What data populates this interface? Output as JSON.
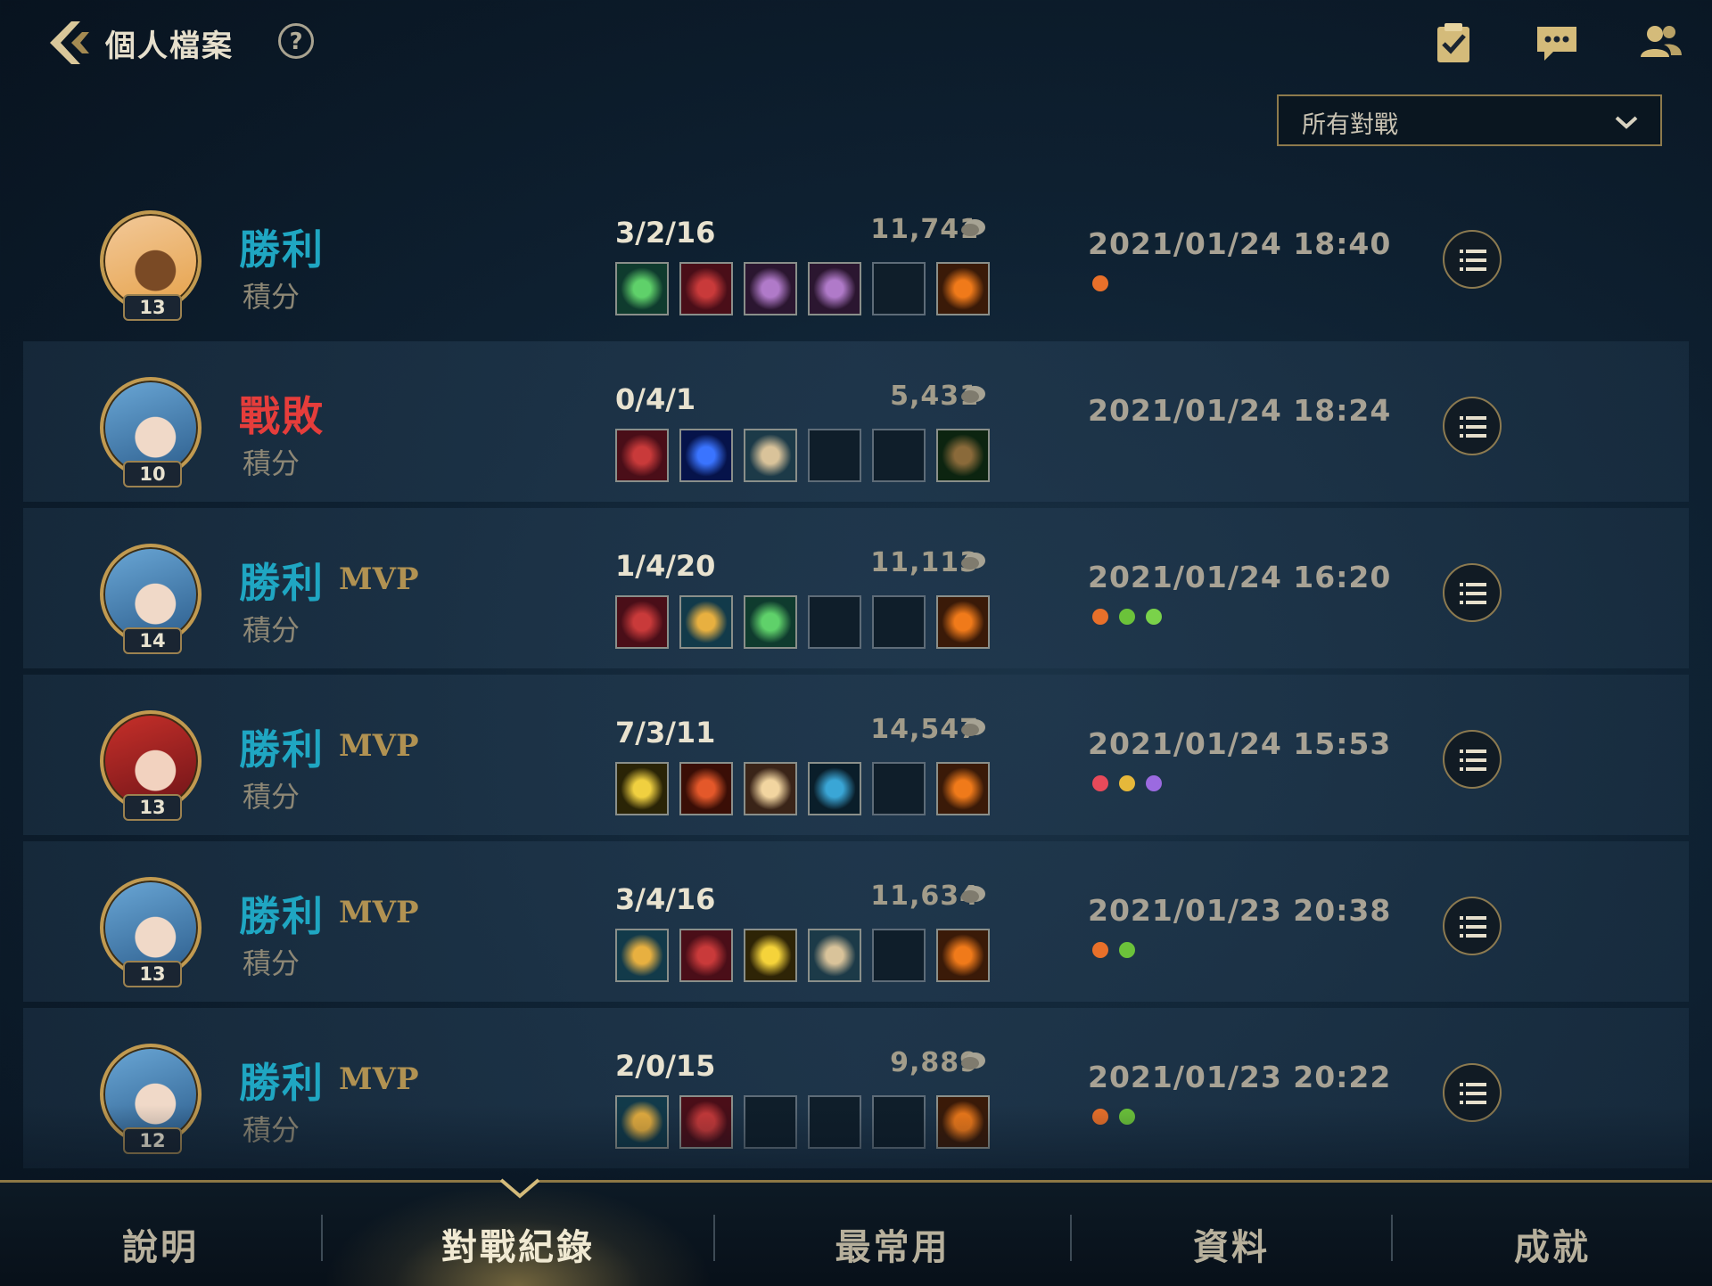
{
  "header": {
    "title": "個人檔案",
    "help_label": "?",
    "filter_value": "所有對戰"
  },
  "colors": {
    "win": "#1fa6c2",
    "lose": "#e53d3b",
    "mvp": "#b19252",
    "gold_border": "#c19a50"
  },
  "matches": [
    {
      "result": "勝利",
      "outcome": "win",
      "mvp": "",
      "mode": "積分",
      "level": "13",
      "kda": "3/2/16",
      "gold": "11,741",
      "datetime": "2021/01/24 18:40",
      "champion_icon": "blonde-champion-portrait",
      "items": [
        "green-gem-item-icon",
        "red-shield-item-icon",
        "spiked-orb-item-icon",
        "spiked-orb-item-icon",
        "empty-slot",
        "winged-ward-trinket-icon"
      ],
      "badges": [
        "orange-streak-badge-icon"
      ]
    },
    {
      "result": "戰敗",
      "outcome": "lose",
      "mvp": "",
      "mode": "積分",
      "level": "10",
      "kda": "0/4/1",
      "gold": "5,431",
      "datetime": "2021/01/24 18:24",
      "champion_icon": "blue-hair-champion-portrait",
      "items": [
        "red-shield-item-icon",
        "blue-flame-item-icon",
        "scroll-item-icon",
        "empty-slot",
        "empty-slot",
        "green-boots-item-icon"
      ],
      "badges": []
    },
    {
      "result": "勝利",
      "outcome": "win",
      "mvp": "MVP",
      "mode": "積分",
      "level": "14",
      "kda": "1/4/20",
      "gold": "11,113",
      "datetime": "2021/01/24 16:20",
      "champion_icon": "blue-hair-champion-portrait",
      "items": [
        "red-shield-item-icon",
        "feather-staff-item-icon",
        "green-gem-item-icon",
        "empty-slot",
        "empty-slot",
        "winged-ward-trinket-icon"
      ],
      "badges": [
        "orange-streak-badge-icon",
        "green-flag-badge-icon",
        "green-ward-badge-icon"
      ]
    },
    {
      "result": "勝利",
      "outcome": "win",
      "mvp": "MVP",
      "mode": "積分",
      "level": "13",
      "kda": "7/3/11",
      "gold": "14,547",
      "datetime": "2021/01/24 15:53",
      "champion_icon": "red-hair-champion-portrait",
      "items": [
        "golden-sword-item-icon",
        "red-blade-item-icon",
        "winged-angel-item-icon",
        "blue-spear-item-icon",
        "empty-slot",
        "winged-ward-trinket-icon"
      ],
      "badges": [
        "crossed-swords-badge-icon",
        "gold-coins-badge-icon",
        "purple-gem-badge-icon"
      ]
    },
    {
      "result": "勝利",
      "outcome": "win",
      "mvp": "MVP",
      "mode": "積分",
      "level": "13",
      "kda": "3/4/16",
      "gold": "11,634",
      "datetime": "2021/01/23 20:38",
      "champion_icon": "blue-hair-champion-portrait",
      "items": [
        "feather-staff-item-icon",
        "red-shield-item-icon",
        "gold-mace-item-icon",
        "scroll-item-icon",
        "empty-slot",
        "winged-ward-trinket-icon"
      ],
      "badges": [
        "orange-streak-badge-icon",
        "green-flag-badge-icon"
      ]
    },
    {
      "result": "勝利",
      "outcome": "win",
      "mvp": "MVP",
      "mode": "積分",
      "level": "12",
      "kda": "2/0/15",
      "gold": "9,889",
      "datetime": "2021/01/23 20:22",
      "champion_icon": "blue-hair-champion-portrait",
      "items": [
        "feather-staff-item-icon",
        "red-shield-item-icon",
        "empty-slot",
        "empty-slot",
        "empty-slot",
        "winged-ward-trinket-icon"
      ],
      "badges": [
        "orange-streak-badge-icon",
        "green-flag-badge-icon"
      ]
    }
  ],
  "tabs": [
    {
      "label": "說明",
      "active": false
    },
    {
      "label": "對戰紀錄",
      "active": true
    },
    {
      "label": "最常用",
      "active": false
    },
    {
      "label": "資料",
      "active": false
    },
    {
      "label": "成就",
      "active": false
    }
  ]
}
